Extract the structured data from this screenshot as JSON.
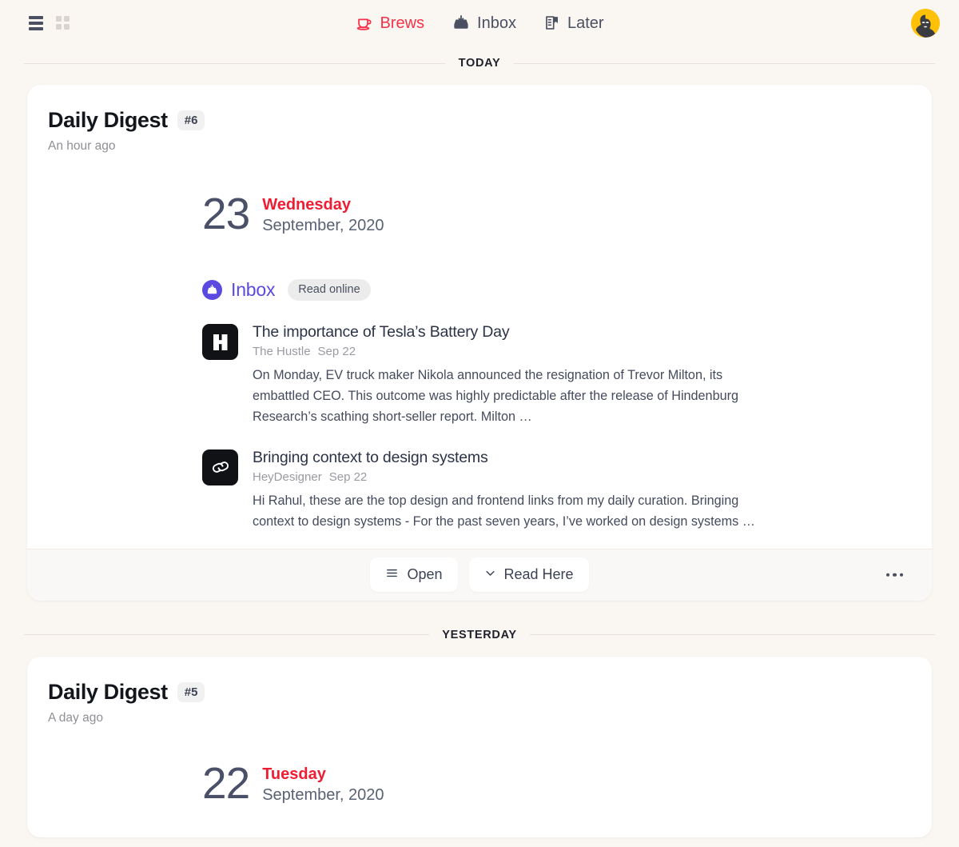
{
  "topbar": {
    "view_list_icon": "list-view-icon",
    "view_grid_icon": "grid-view-icon",
    "nav": [
      {
        "label": "Brews",
        "icon": "coffee-cup-icon",
        "active": true
      },
      {
        "label": "Inbox",
        "icon": "inbox-tray-icon",
        "active": false
      },
      {
        "label": "Later",
        "icon": "bookmark-document-icon",
        "active": false
      }
    ],
    "avatar": "user-avatar"
  },
  "colors": {
    "page_bg": "#faf6f2",
    "accent_red": "#f8314a",
    "day_red": "#ef1d33",
    "source_purple": "#5b4ae0",
    "text_dark": "#14161d",
    "text_muted": "#8f8f96",
    "avatar_bg": "#ffc107"
  },
  "sections": [
    {
      "label": "TODAY",
      "card": {
        "title": "Daily Digest",
        "badge": "#6",
        "time": "An hour ago",
        "date": {
          "day_number": "23",
          "weekday": "Wednesday",
          "month_year": "September, 2020"
        },
        "source": {
          "name": "Inbox",
          "icon": "inbox-tray-icon",
          "pill": "Read online"
        },
        "articles": [
          {
            "icon": "hustle-logo-icon",
            "title": "The importance of Tesla’s Battery Day",
            "publisher": "The Hustle",
            "date": "Sep 22",
            "excerpt": "On Monday, EV truck maker Nikola announced the resignation of Trevor Milton, its embattled CEO. This outcome was highly predictable after the release of Hindenburg Research’s scathing short-seller report.  Milton …"
          },
          {
            "icon": "link-chain-icon",
            "title": "Bringing context to design systems",
            "publisher": "HeyDesigner",
            "date": "Sep 22",
            "excerpt": "Hi Rahul, these are the top design and frontend links from my daily curation. Bringing context to design systems - For the past seven years, I’ve worked on design systems …"
          }
        ],
        "footer": {
          "open_label": "Open",
          "open_icon": "list-lines-icon",
          "read_here_label": "Read Here",
          "read_here_icon": "chevron-down-icon",
          "more_icon": "more-horizontal-icon"
        }
      }
    },
    {
      "label": "YESTERDAY",
      "card": {
        "title": "Daily Digest",
        "badge": "#5",
        "time": "A day ago",
        "date": {
          "day_number": "22",
          "weekday": "Tuesday",
          "month_year": "September, 2020"
        }
      }
    }
  ]
}
